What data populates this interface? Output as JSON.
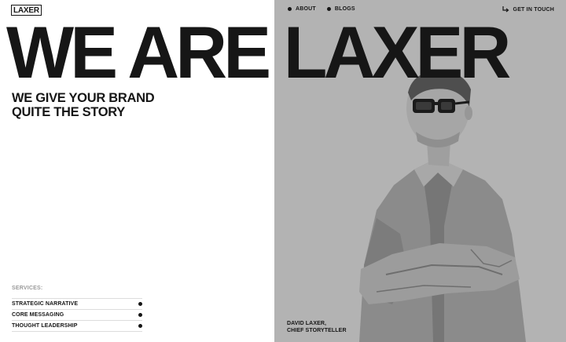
{
  "brand": {
    "logo": "LAXER"
  },
  "nav": {
    "items": [
      {
        "label": "ABOUT"
      },
      {
        "label": "BLOGS"
      }
    ],
    "cta": "GET IN TOUCH",
    "cta_icon": "arrow-return-right-icon"
  },
  "hero": {
    "headline": "WE ARE LAXER",
    "tagline_line1": "WE GIVE YOUR BRAND",
    "tagline_line2": "QUITE THE STORY"
  },
  "services": {
    "label": "SERVICES:",
    "items": [
      {
        "label": "STRATEGIC NARRATIVE"
      },
      {
        "label": "CORE MESSAGING"
      },
      {
        "label": "THOUGHT LEADERSHIP"
      }
    ]
  },
  "portrait": {
    "name": "DAVID LAXER,",
    "role": "CHIEF STORYTELLER"
  },
  "colors": {
    "ink": "#161616",
    "panel": "#b3b3b3",
    "background": "#ffffff",
    "muted": "#9a9a9a"
  }
}
